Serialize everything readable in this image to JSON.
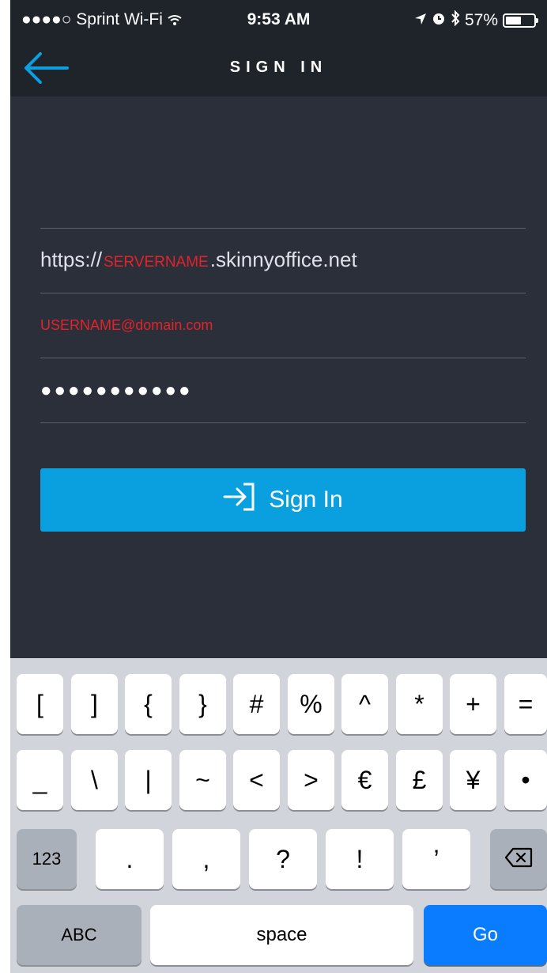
{
  "status_bar": {
    "carrier": "●●●●○ Sprint Wi-Fi",
    "time": "9:53 AM",
    "battery": "57%",
    "battery_level": 0.57
  },
  "nav": {
    "title": "SIGN IN"
  },
  "form": {
    "server_prefix": "https://",
    "server_name": "SERVERNAME",
    "server_suffix": ".skinnyoffice.net",
    "username": "USERNAME@domain.com",
    "password": "●●●●●●●●●●●"
  },
  "signin_button": {
    "label": "Sign In"
  },
  "keyboard": {
    "row1": [
      "[",
      "]",
      "{",
      "}",
      "#",
      "%",
      "^",
      "*",
      "+",
      "="
    ],
    "row2": [
      "_",
      "\\",
      "|",
      "~",
      "<",
      ">",
      "€",
      "£",
      "¥",
      "•"
    ],
    "row3": [
      ".",
      ",",
      "?",
      "!",
      "’"
    ],
    "numbers_key": "123",
    "abc_key": "ABC",
    "space_key": "space",
    "go_key": "Go"
  },
  "colors": {
    "accent": "#0aa0df",
    "go": "#0a7cff",
    "highlight": "#e2232a"
  }
}
